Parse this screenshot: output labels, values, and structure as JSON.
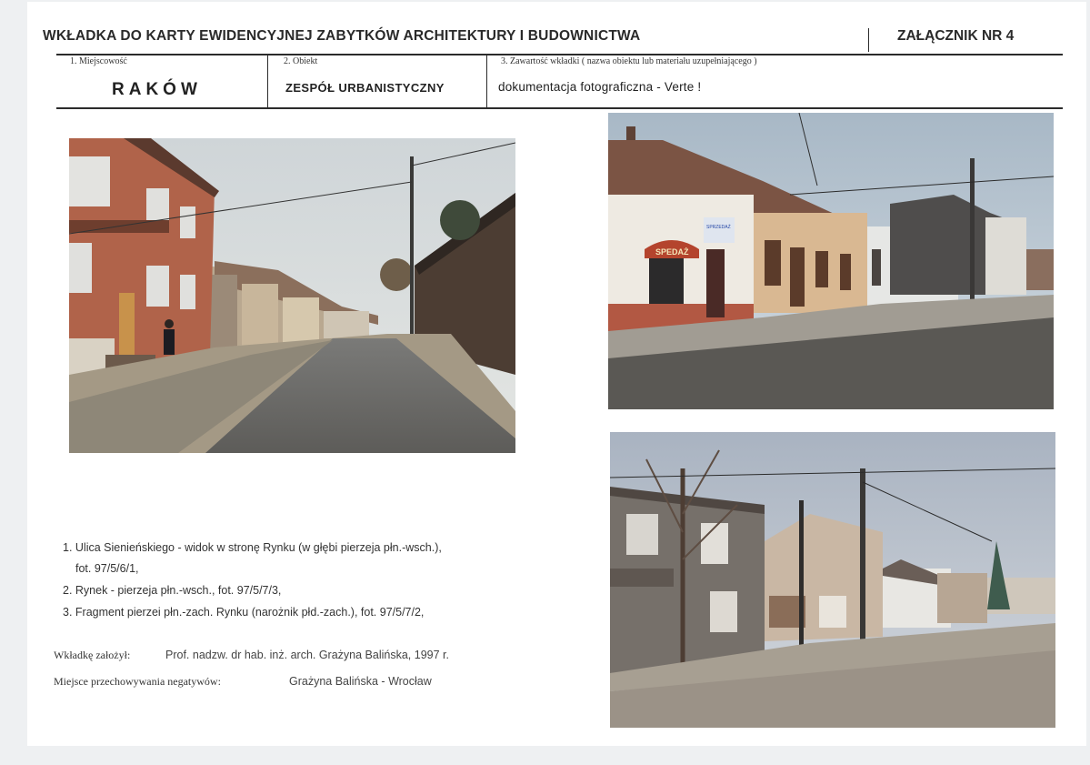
{
  "header": {
    "title": "WKŁADKA DO KARTY EWIDENCYJNEJ ZABYTKÓW ARCHITEKTURY I BUDOWNICTWA",
    "annex": "ZAŁĄCZNIK NR 4"
  },
  "fields": {
    "location_label": "1. Miejscowość",
    "location_value": "RAKÓW",
    "object_label": "2. Obiekt",
    "object_value": "ZESPÓŁ URBANISTYCZNY",
    "content_label": "3. Zawartość wkładki ( nazwa obiektu lub materiału uzupełniającego )",
    "content_value": "dokumentacja fotograficzna - Verte !"
  },
  "photos": [
    {
      "name": "photo-street-sienienskiego",
      "icon": "photograph"
    },
    {
      "name": "photo-market-ne-frontage",
      "icon": "photograph"
    },
    {
      "name": "photo-market-nw-frontage-corner",
      "icon": "photograph"
    }
  ],
  "captions": {
    "item1_line1": "1. Ulica Sienieńskiego - widok w stronę Rynku (w głębi pierzeja płn.-wsch.),",
    "item1_line2": "fot. 97/5/6/1,",
    "item2": "2. Rynek - pierzeja płn.-wsch., fot. 97/5/7/3,",
    "item3": "3. Fragment pierzei płn.-zach. Rynku (narożnik płd.-zach.), fot. 97/5/7/2,"
  },
  "meta": {
    "author_label": "Wkładkę założył:",
    "author_value": "Prof. nadzw. dr hab. inż. arch. Grażyna Balińska, 1997 r.",
    "storage_label": "Miejsce przechowywania negatywów:",
    "storage_value": "Grażyna Balińska - Wrocław"
  },
  "photo_signs": {
    "shop_awning": "SPEDAŻ",
    "shop_sign": "SPRZEDAŻ"
  }
}
